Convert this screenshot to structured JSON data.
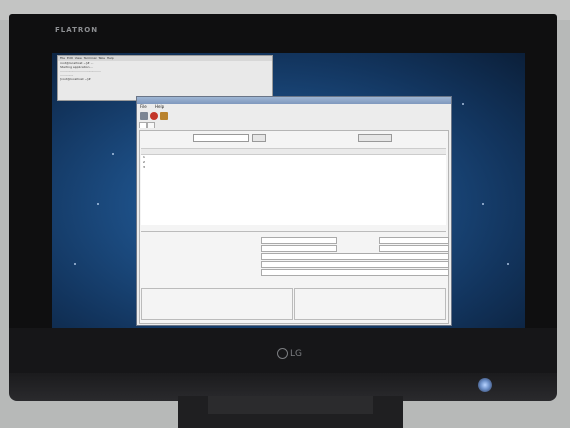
{
  "monitor": {
    "brand_top": "FLATRON",
    "brand_bottom": "LG"
  },
  "terminal": {
    "menu": [
      "File",
      "Edit",
      "View",
      "Terminal",
      "Tabs",
      "Help"
    ],
    "lines": [
      "root@localhost ~]# ...",
      "Starting application ...",
      "...........................................",
      "..............",
      "[root@localhost ~]#"
    ]
  },
  "app": {
    "title": "",
    "menu": [
      "File",
      "Help"
    ],
    "tabs": [
      "",
      ""
    ],
    "search": {
      "label": "",
      "button": "",
      "right_button": ""
    },
    "list_section": "",
    "grid": {
      "headers": [
        "",
        "",
        "",
        "",
        "",
        "",
        ""
      ],
      "rows": [
        [
          "1",
          "",
          "",
          "",
          "",
          "",
          ""
        ],
        [
          "2",
          "",
          "",
          "",
          "",
          "",
          ""
        ],
        [
          "3",
          "",
          "",
          "",
          "",
          "",
          ""
        ]
      ]
    },
    "detail_section": "",
    "detail_left_label": "",
    "fields": [
      "",
      "",
      "",
      "",
      "",
      "",
      ""
    ],
    "bottom": [
      {
        "title": "",
        "value": ""
      },
      {
        "title": "",
        "value": ""
      }
    ]
  },
  "colors": {
    "screen_center": "#2e6aa5",
    "screen_edge": "#0b1f39",
    "bezel": "#0f0f10"
  },
  "icons": {
    "toolbar": [
      "printer-icon",
      "stop-icon",
      "exit-icon"
    ],
    "power": "power-button-icon"
  }
}
